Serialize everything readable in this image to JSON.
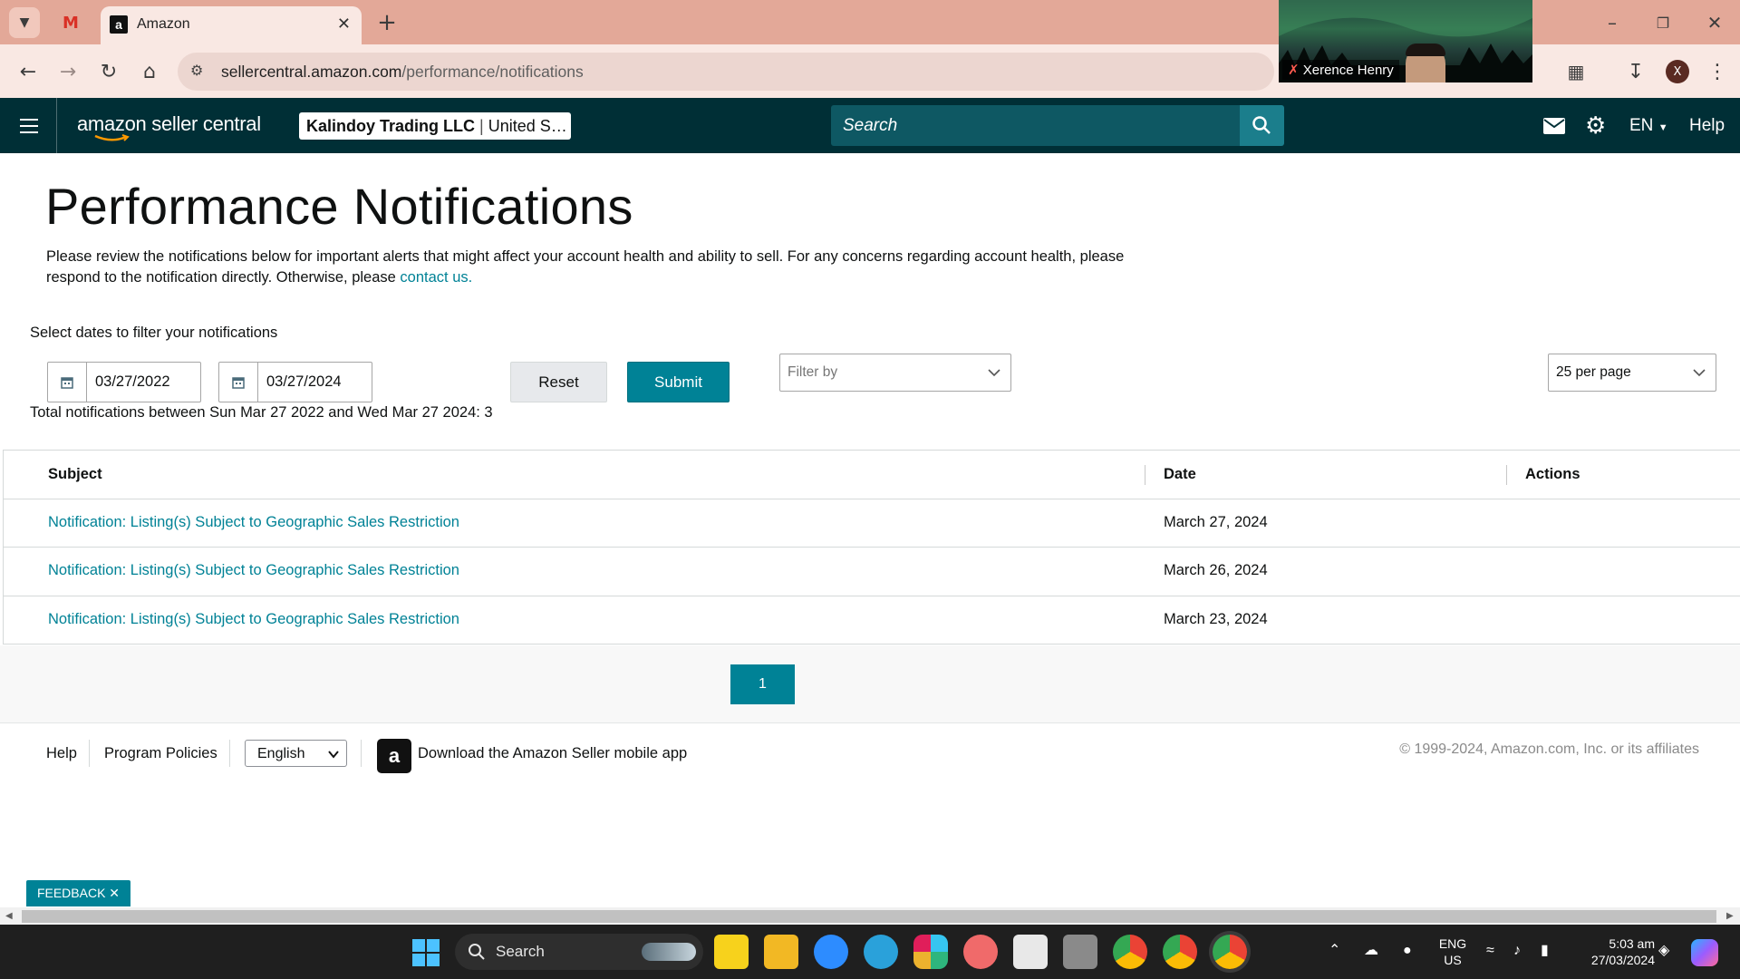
{
  "browser": {
    "tab_title": "Amazon",
    "url_host": "sellercentral.amazon.com",
    "url_path": "/performance/notifications",
    "profile_initial": "X"
  },
  "video_call": {
    "participant_name": "Xerence Henry"
  },
  "header": {
    "logo_text": "amazon seller central",
    "account_name": "Kalindoy Trading LLC",
    "account_region": "United S…",
    "search_placeholder": "Search",
    "language": "EN",
    "help": "Help"
  },
  "page": {
    "title": "Performance Notifications",
    "intro_text": "Please review the notifications below for important alerts that might affect your account health and ability to sell. For any concerns regarding account health, please respond to the notification directly. Otherwise, please ",
    "intro_link": "contact us.",
    "filter_label": "Select dates to filter your notifications",
    "start_date": "03/27/2022",
    "end_date": "03/27/2024",
    "reset_label": "Reset",
    "submit_label": "Submit",
    "filter_by_placeholder": "Filter by",
    "per_page": "25 per page",
    "total_line": "Total notifications between Sun Mar 27 2022 and Wed Mar 27 2024: 3"
  },
  "table": {
    "headers": {
      "subject": "Subject",
      "date": "Date",
      "actions": "Actions"
    },
    "rows": [
      {
        "subject": "Notification: Listing(s) Subject to Geographic Sales Restriction",
        "date": "March 27, 2024"
      },
      {
        "subject": "Notification: Listing(s) Subject to Geographic Sales Restriction",
        "date": "March 26, 2024"
      },
      {
        "subject": "Notification: Listing(s) Subject to Geographic Sales Restriction",
        "date": "March 23, 2024"
      }
    ]
  },
  "pagination": {
    "current_page": "1"
  },
  "footer": {
    "help": "Help",
    "program_policies": "Program Policies",
    "language": "English",
    "app_icon_letter": "a",
    "download_app": "Download the Amazon Seller mobile app",
    "copyright": "© 1999-2024, Amazon.com, Inc. or its affiliates"
  },
  "feedback_label": "FEEDBACK ✕",
  "taskbar": {
    "search_label": "Search",
    "input_lang_line1": "ENG",
    "input_lang_line2": "US",
    "time": "5:03 am",
    "date": "27/03/2024"
  },
  "colors": {
    "header_bg": "#002f36",
    "accent_teal": "#008296",
    "tabbar_bg": "#e3a898",
    "taskbar_bg": "#1f1f1f"
  }
}
